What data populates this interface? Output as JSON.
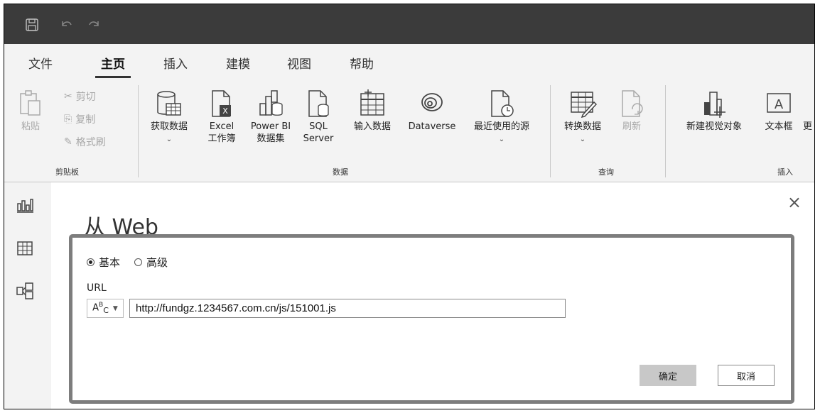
{
  "titlebar": {
    "icons": [
      "save-icon",
      "undo-icon",
      "redo-icon"
    ]
  },
  "menu": {
    "items": [
      {
        "label": "文件"
      },
      {
        "label": "主页"
      },
      {
        "label": "插入"
      },
      {
        "label": "建模"
      },
      {
        "label": "视图"
      },
      {
        "label": "帮助"
      }
    ],
    "active": "主页"
  },
  "ribbon": {
    "clipboard": {
      "paste": "粘贴",
      "cut": "剪切",
      "copy": "复制",
      "format_painter": "格式刷",
      "group_label": "剪贴板"
    },
    "data": {
      "get_data_line1": "获取数据",
      "get_data_caret": "⌄",
      "excel_line1": "Excel",
      "excel_line2": "工作簿",
      "powerbi_line1": "Power BI",
      "powerbi_line2": "数据集",
      "sql_line1": "SQL",
      "sql_line2": "Server",
      "enter_data": "输入数据",
      "dataverse": "Dataverse",
      "recent_line1": "最近使用的源",
      "recent_caret": "⌄",
      "group_label": "数据"
    },
    "query": {
      "transform_line1": "转换数据",
      "transform_caret": "⌄",
      "refresh": "刷新",
      "group_label": "查询"
    },
    "insert": {
      "new_visual": "新建视觉对象",
      "textbox": "文本框",
      "more": "更",
      "group_label": "插入"
    }
  },
  "leftrail": {
    "icons": [
      "report-view-icon",
      "table-view-icon",
      "model-view-icon"
    ]
  },
  "dialog": {
    "title": "从 Web",
    "close": "×",
    "mode_basic": "基本",
    "mode_advanced": "高级",
    "selected_mode": "基本",
    "url_label": "URL",
    "type_indicator": "Aᴮᴄ",
    "url_value": "http://fundgz.1234567.com.cn/js/151001.js",
    "ok": "确定",
    "cancel": "取消"
  }
}
